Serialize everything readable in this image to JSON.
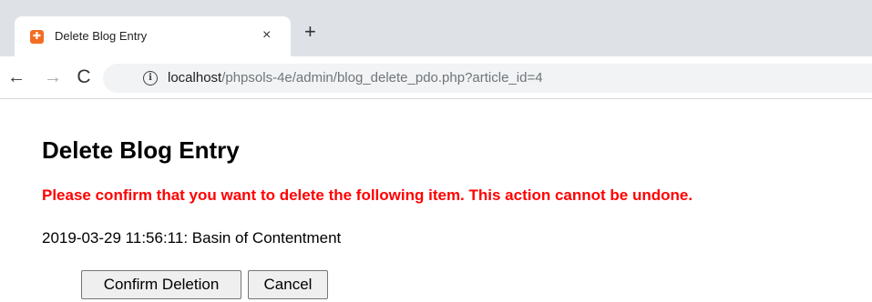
{
  "browser": {
    "tab": {
      "title": "Delete Blog Entry",
      "close_glyph": "×",
      "favicon": "xampp-icon"
    },
    "new_tab_glyph": "+",
    "nav": {
      "back_glyph": "←",
      "forward_glyph": "→",
      "reload_glyph": "C"
    },
    "address": {
      "host": "localhost",
      "path": "/phpsols-4e/admin/blog_delete_pdo.php?article_id=4",
      "info_glyph": "i"
    }
  },
  "page": {
    "heading": "Delete Blog Entry",
    "warning": "Please confirm that you want to delete the following item. This action cannot be undone.",
    "warning_color": "#ff0000",
    "entry": "2019-03-29 11:56:11: Basin of Contentment",
    "confirm_label": "Confirm Deletion",
    "cancel_label": "Cancel"
  }
}
